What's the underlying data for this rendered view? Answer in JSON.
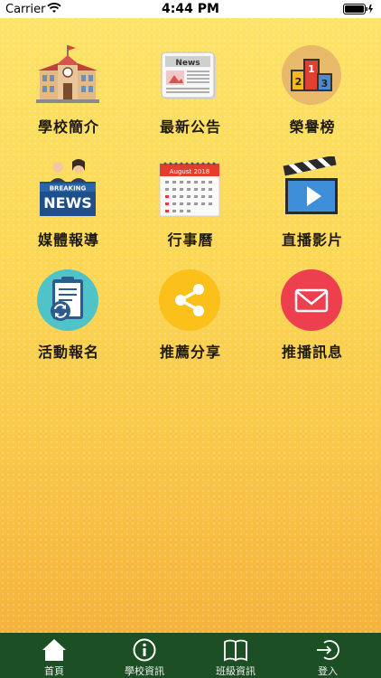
{
  "status_bar": {
    "carrier": "Carrier",
    "time": "4:44 PM"
  },
  "menu": {
    "school_intro": "學校簡介",
    "announcements": "最新公告",
    "honor_roll": "榮譽榜",
    "media_reports": "媒體報導",
    "calendar": "行事曆",
    "live_video": "直播影片",
    "event_signup": "活動報名",
    "recommend_share": "推薦分享",
    "push_messages": "推播訊息"
  },
  "icon_text": {
    "news_header": "News",
    "breaking": "BREAKING",
    "news_big": "NEWS",
    "calendar_month": "August 2018",
    "podium": [
      "2",
      "1",
      "3"
    ]
  },
  "tabbar": {
    "home": "首頁",
    "school_info": "學校資訊",
    "class_info": "班級資訊",
    "login": "登入"
  },
  "colors": {
    "tabbar_bg": "#1c4f23",
    "share_circle": "#fbc11a",
    "mail_circle": "#ee3f4e",
    "calendar_red": "#e53c2e"
  }
}
